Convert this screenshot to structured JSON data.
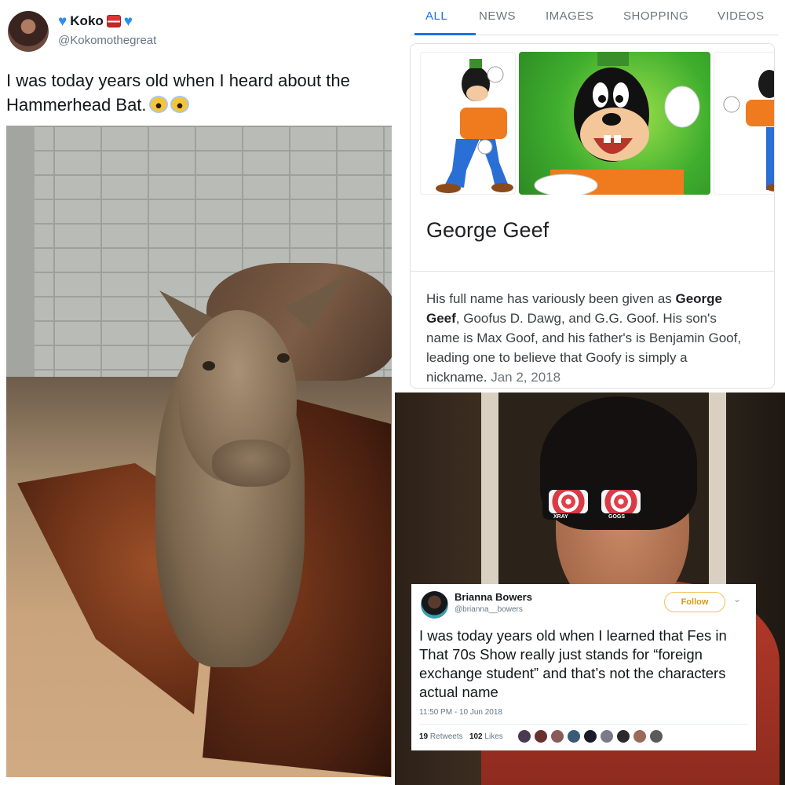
{
  "tweet1": {
    "name": "Koko",
    "handle": "@Kokomothegreat",
    "text": "I was today years old when I heard about the Hammerhead Bat."
  },
  "search": {
    "tabs": [
      "ALL",
      "NEWS",
      "IMAGES",
      "SHOPPING",
      "VIDEOS"
    ],
    "active_tab": "ALL",
    "panel": {
      "title": "George Geef",
      "desc_part1": "His full name has variously been given as ",
      "desc_bold": "George Geef",
      "desc_part2": ", Goofus D. Dawg, and G.G. Goof. His son's name is Max Goof, and his father's is Benjamin Goof, leading one to believe that Goofy is simply a nickname.",
      "date": "Jan 2, 2018"
    }
  },
  "glasses": {
    "left_label": "XRAY",
    "right_label": "GOGS"
  },
  "tweet2": {
    "name": "Brianna Bowers",
    "handle": "@brianna__bowers",
    "follow_label": "Follow",
    "text": "I was today years old when I learned that Fes in That 70s Show really just stands for “foreign exchange student” and that’s not the characters actual name",
    "timestamp": "11:50 PM - 10 Jun 2018",
    "retweets_count": "19",
    "retweets_label": "Retweets",
    "likes_count": "102",
    "likes_label": "Likes"
  },
  "colors": {
    "twitter_blue": "#2c8ef0",
    "google_blue": "#1a73e8",
    "follow_orange": "#d99a1a"
  }
}
